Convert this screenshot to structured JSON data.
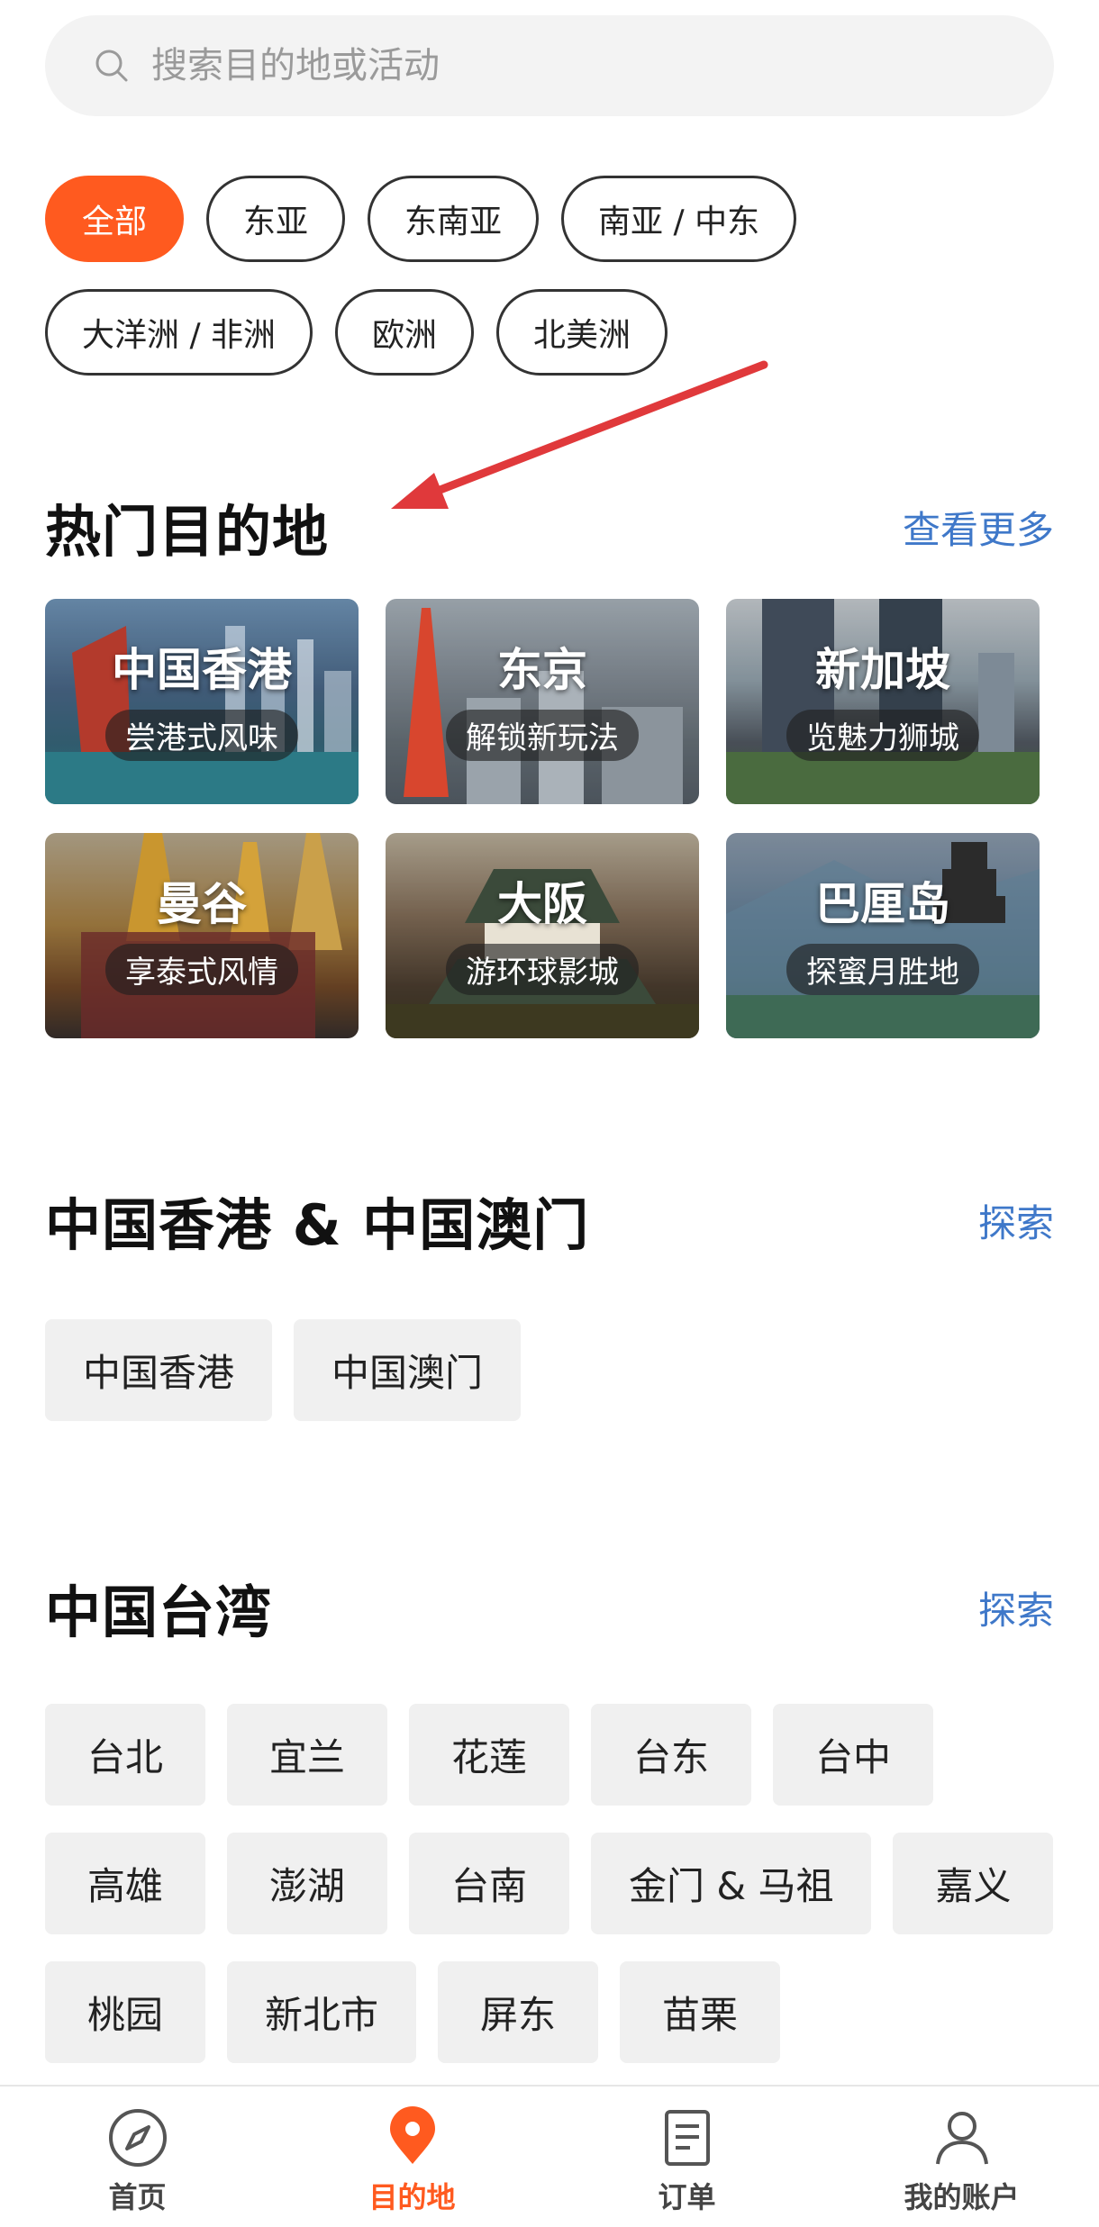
{
  "search": {
    "placeholder": "搜索目的地或活动"
  },
  "regions": [
    {
      "label": "全部",
      "active": true
    },
    {
      "label": "东亚"
    },
    {
      "label": "东南亚"
    },
    {
      "label": "南亚 / 中东"
    },
    {
      "label": "大洋洲 / 非洲"
    },
    {
      "label": "欧洲"
    },
    {
      "label": "北美洲"
    }
  ],
  "hot": {
    "title": "热门目的地",
    "more": "查看更多",
    "cards": [
      {
        "title": "中国香港",
        "subtitle": "尝港式风味"
      },
      {
        "title": "东京",
        "subtitle": "解锁新玩法"
      },
      {
        "title": "新加坡",
        "subtitle": "览魅力狮城"
      },
      {
        "title": "曼谷",
        "subtitle": "享泰式风情"
      },
      {
        "title": "大阪",
        "subtitle": "游环球影城"
      },
      {
        "title": "巴厘岛",
        "subtitle": "探蜜月胜地"
      }
    ]
  },
  "hkmacau": {
    "title": "中国香港 & 中国澳门",
    "link": "探索",
    "items": [
      "中国香港",
      "中国澳门"
    ]
  },
  "taiwan": {
    "title": "中国台湾",
    "link": "探索",
    "items": [
      "台北",
      "宜兰",
      "花莲",
      "台东",
      "台中",
      "高雄",
      "澎湖",
      "台南",
      "金门 & 马祖",
      "嘉义",
      "桃园",
      "新北市",
      "屏东",
      "苗栗"
    ]
  },
  "nav": [
    {
      "label": "首页",
      "icon": "compass-icon"
    },
    {
      "label": "目的地",
      "icon": "location-pin-icon",
      "active": true
    },
    {
      "label": "订单",
      "icon": "document-icon"
    },
    {
      "label": "我的账户",
      "icon": "user-icon"
    }
  ],
  "colors": {
    "accent": "#ff5a1f",
    "link": "#3f78c9",
    "annotation": "#e0393b"
  }
}
